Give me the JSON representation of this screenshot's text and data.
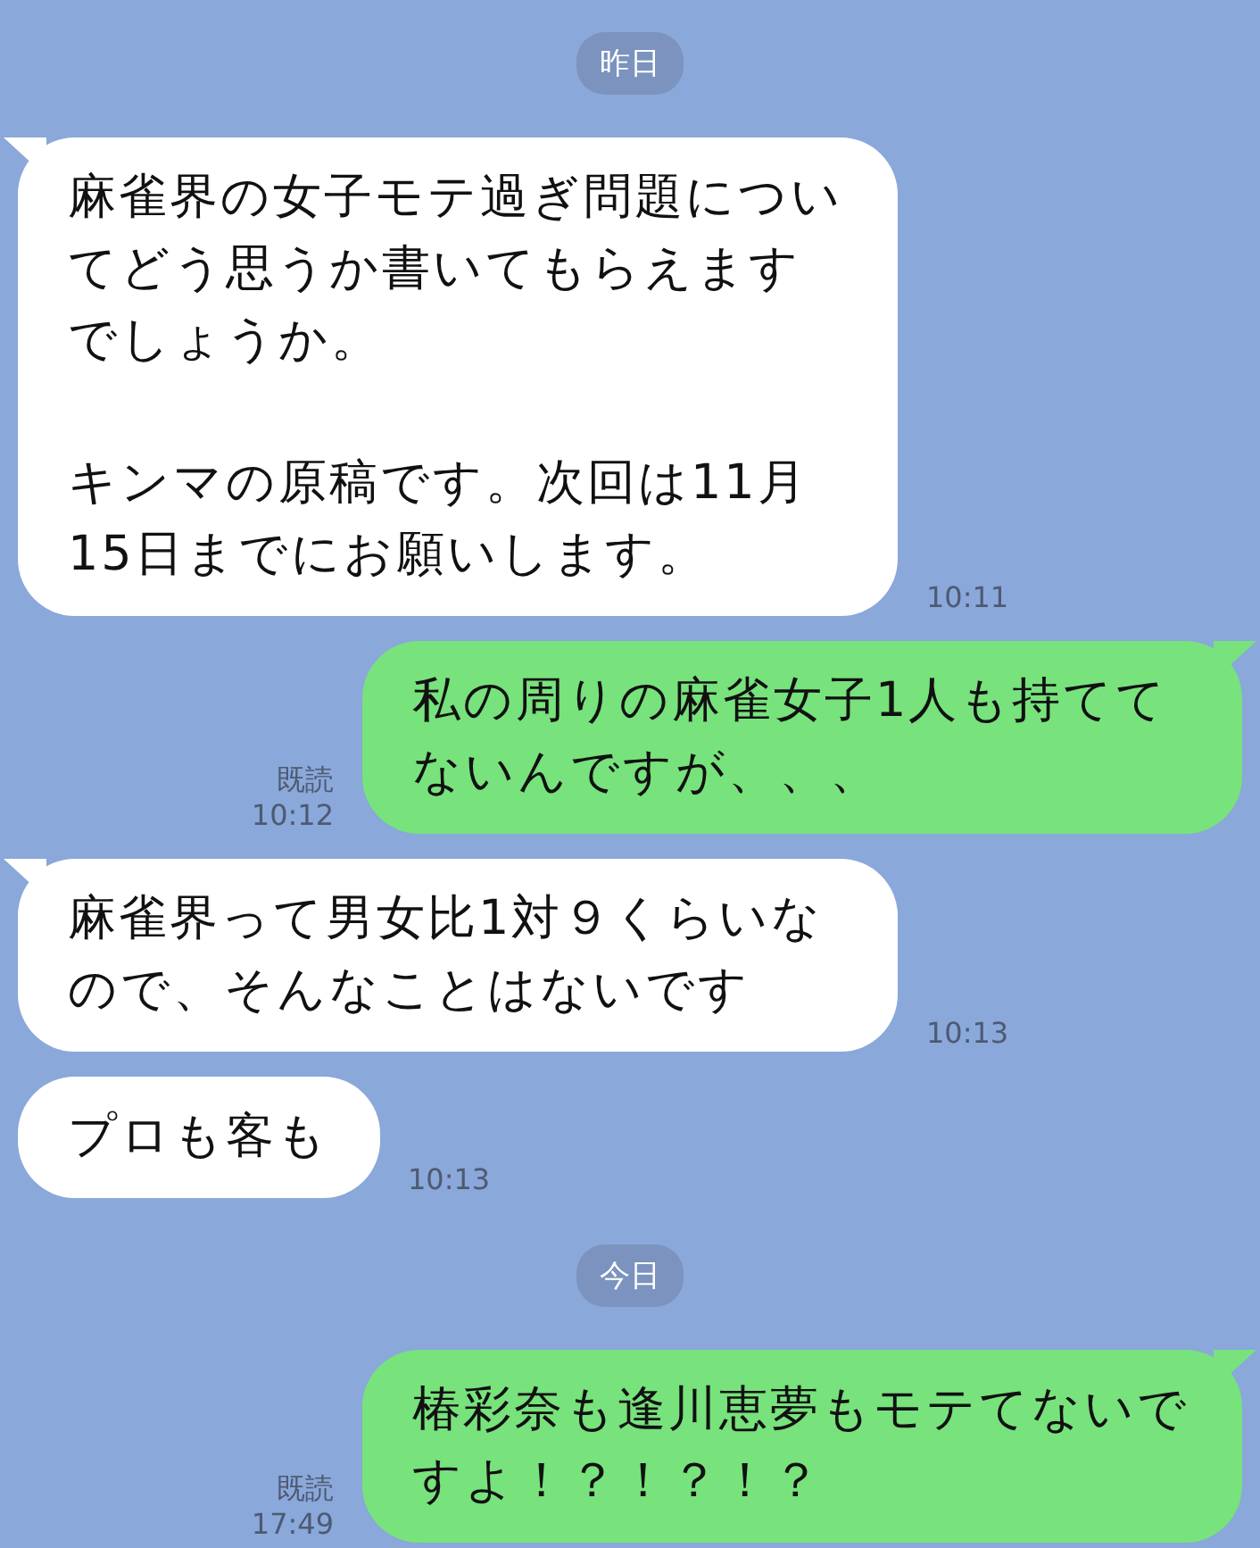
{
  "items": [
    {
      "kind": "date",
      "text": "昨日"
    },
    {
      "kind": "incoming",
      "tail": true,
      "paragraphs": [
        "麻雀界の女子モテ過ぎ問題についてどう思うか書いてもらえますでしょうか。",
        "キンマの原稿です。次回は11月15日までにお願いします。"
      ],
      "time": "10:11"
    },
    {
      "kind": "outgoing",
      "tail": true,
      "paragraphs": [
        "私の周りの麻雀女子1人も持ててないんですが、、、"
      ],
      "read": "既読",
      "time": "10:12"
    },
    {
      "kind": "incoming",
      "tail": true,
      "paragraphs": [
        "麻雀界って男女比1対９くらいなので、そんなことはないです"
      ],
      "time": "10:13"
    },
    {
      "kind": "incoming",
      "tail": false,
      "paragraphs": [
        "プロも客も"
      ],
      "time": "10:13"
    },
    {
      "kind": "date",
      "text": "今日"
    },
    {
      "kind": "outgoing",
      "tail": true,
      "paragraphs": [
        "椿彩奈も逢川恵夢もモテてないですよ！？！？！？"
      ],
      "read": "既読",
      "time": "17:49"
    }
  ]
}
